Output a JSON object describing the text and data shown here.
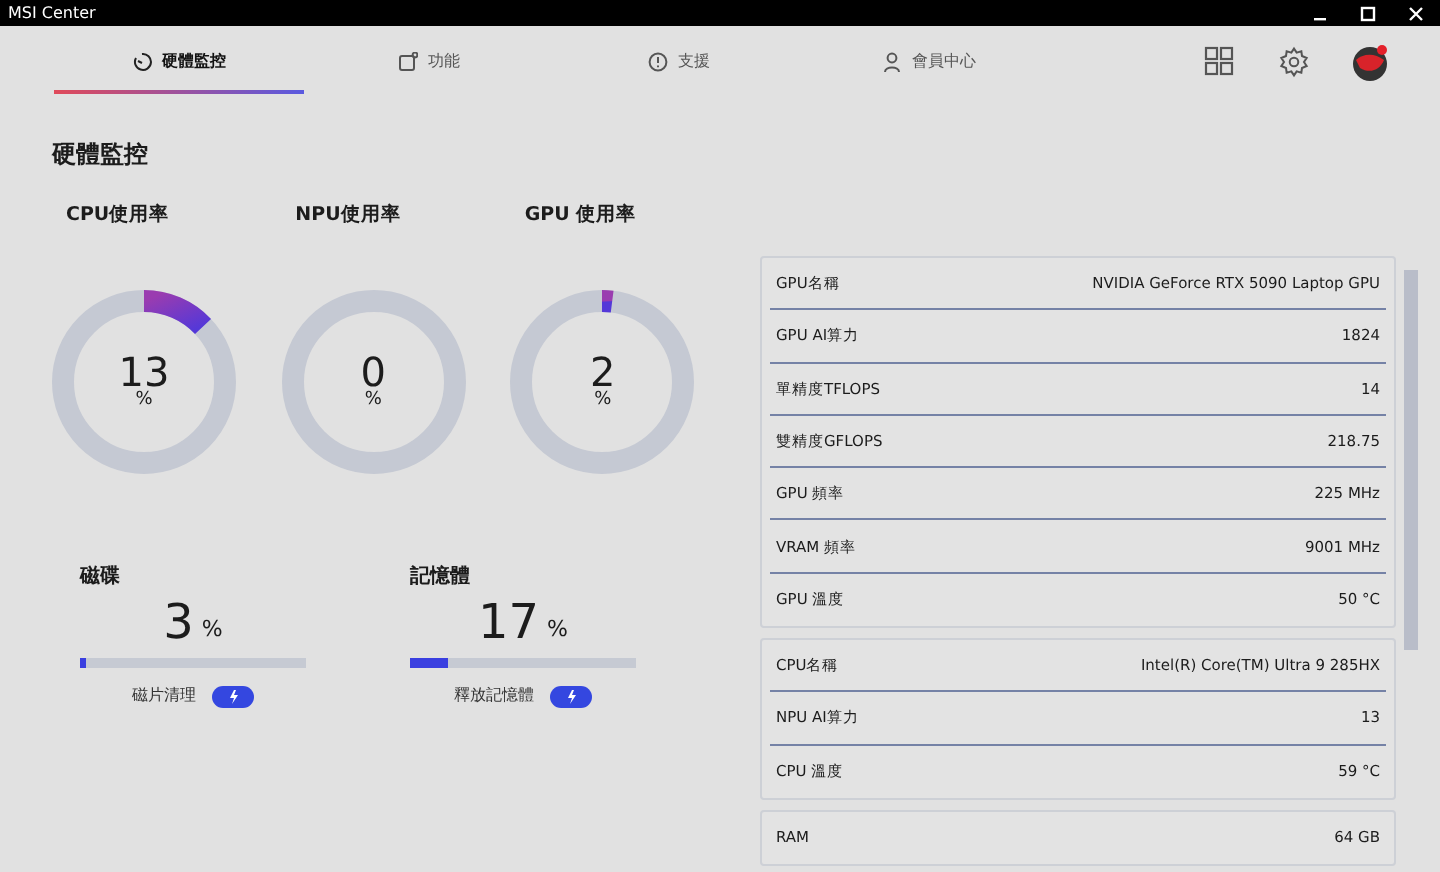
{
  "window": {
    "title": "MSI Center"
  },
  "tabs": [
    {
      "label": "硬體監控",
      "selected": true
    },
    {
      "label": "功能",
      "selected": false
    },
    {
      "label": "支援",
      "selected": false
    },
    {
      "label": "會員中心",
      "selected": false
    }
  ],
  "page_title": "硬體監控",
  "gauges": [
    {
      "label": "CPU使用率",
      "value": "13",
      "unit": "%"
    },
    {
      "label": "NPU使用率",
      "value": "0",
      "unit": "%"
    },
    {
      "label": "GPU 使用率",
      "value": "2",
      "unit": "%"
    }
  ],
  "meters": [
    {
      "label": "磁碟",
      "value": "3",
      "unit": "%",
      "level": 0.03,
      "action": "磁片清理"
    },
    {
      "label": "記憶體",
      "value": "17",
      "unit": "%",
      "level": 0.17,
      "action": "釋放記憶體"
    }
  ],
  "info_groups": [
    {
      "rows": [
        {
          "label": "GPU名稱",
          "value": "NVIDIA GeForce RTX 5090 Laptop GPU"
        },
        {
          "label": "GPU AI算力",
          "value": "1824"
        },
        {
          "label": "單精度TFLOPS",
          "value": "14"
        },
        {
          "label": "雙精度GFLOPS",
          "value": "218.75"
        },
        {
          "label": "GPU 頻率",
          "value": "225 MHz"
        },
        {
          "label": "VRAM 頻率",
          "value": "9001 MHz"
        },
        {
          "label": "GPU 溫度",
          "value": "50 °C"
        }
      ]
    },
    {
      "rows": [
        {
          "label": "CPU名稱",
          "value": "Intel(R) Core(TM) Ultra 9 285HX"
        },
        {
          "label": "NPU AI算力",
          "value": "13"
        },
        {
          "label": "CPU 溫度",
          "value": "59 °C"
        }
      ]
    },
    {
      "rows": [
        {
          "label": "RAM",
          "value": "64 GB"
        }
      ]
    }
  ]
}
